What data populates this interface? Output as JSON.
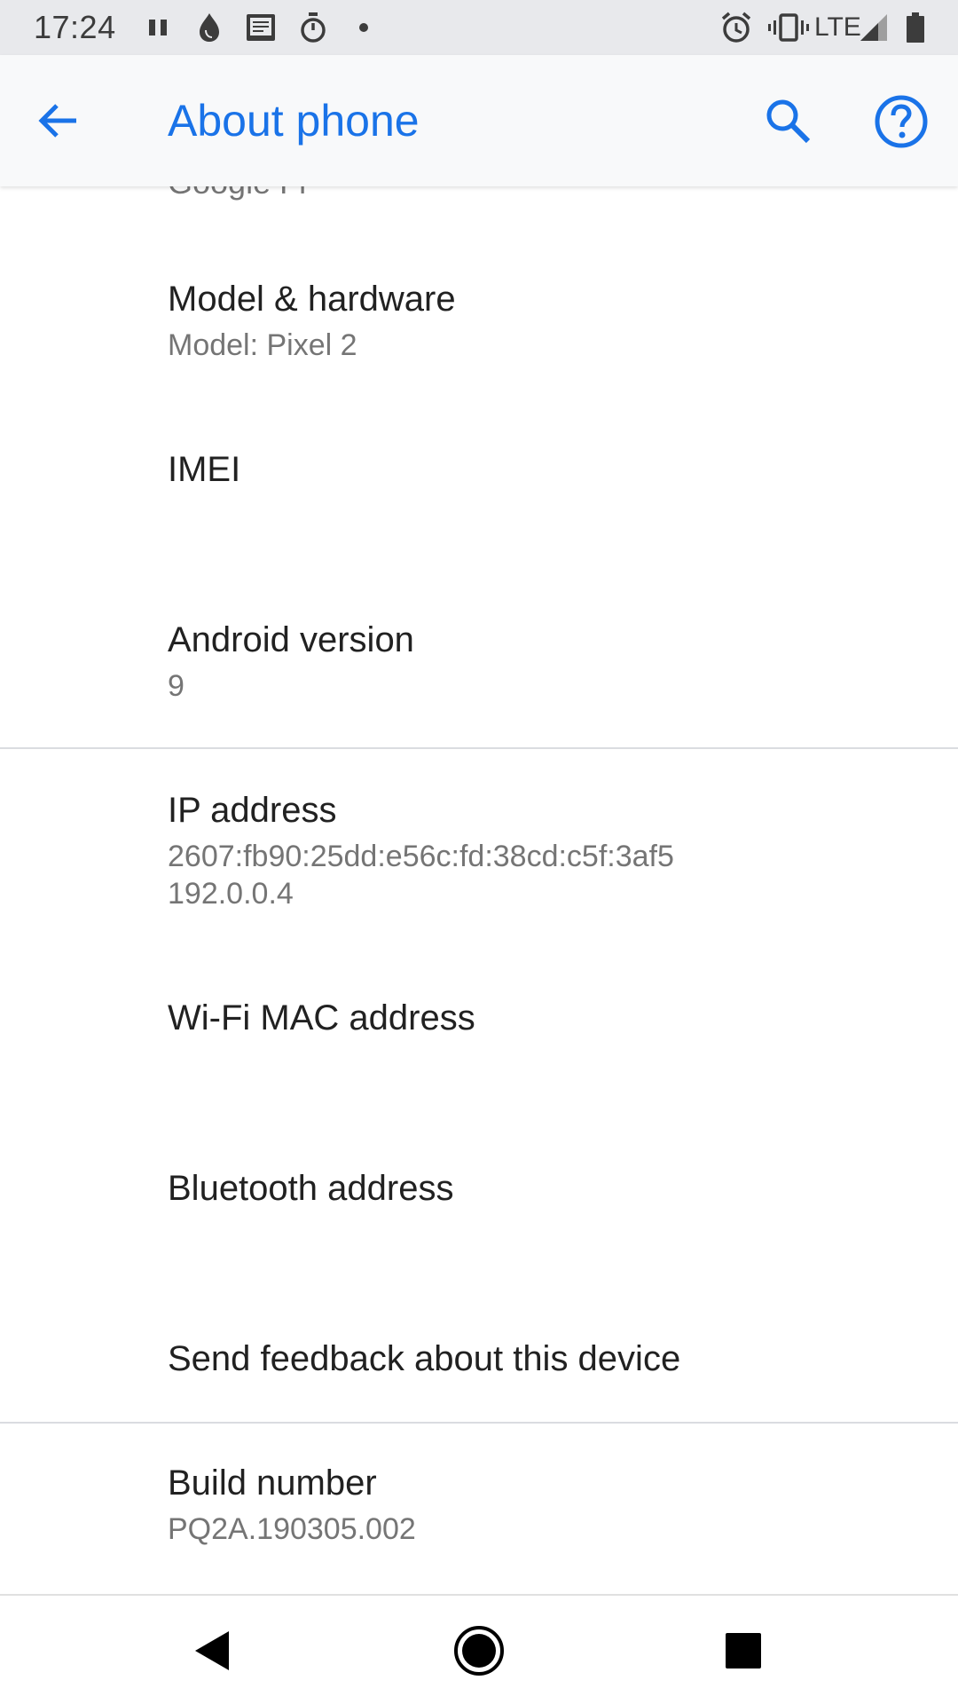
{
  "status_bar": {
    "time": "17:24",
    "network": "LTE",
    "icons": [
      "pause-icon",
      "drop-icon",
      "bible-icon",
      "stopwatch-icon",
      "dot-icon",
      "alarm-icon",
      "vibrate-icon",
      "signal-icon",
      "battery-icon"
    ]
  },
  "app_bar": {
    "title": "About phone",
    "accent_color": "#1a73e8"
  },
  "content": {
    "partial_top_text": "Google Fi",
    "items": [
      {
        "title": "Model & hardware",
        "summary": "Model: Pixel 2"
      },
      {
        "title": "IMEI",
        "summary": ""
      },
      {
        "title": "Android version",
        "summary": "9"
      },
      {
        "title": "IP address",
        "summary": "2607:fb90:25dd:e56c:fd:38cd:c5f:3af5\n192.0.0.4"
      },
      {
        "title": "Wi-Fi MAC address",
        "summary": ""
      },
      {
        "title": "Bluetooth address",
        "summary": ""
      },
      {
        "title": "Send feedback about this device",
        "summary": ""
      },
      {
        "title": "Build number",
        "summary": "PQ2A.190305.002"
      }
    ]
  },
  "nav_bar": {
    "buttons": [
      "back-icon",
      "home-icon",
      "recents-icon"
    ]
  }
}
